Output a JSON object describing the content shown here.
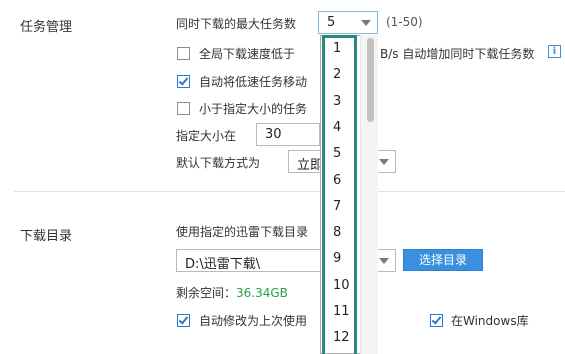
{
  "task_section": {
    "title": "任务管理",
    "max_tasks_label": "同时下载的最大任务数",
    "max_tasks_value": "5",
    "max_tasks_range": "(1-50)",
    "global_speed_label": "全局下载速度低于",
    "global_speed_suffix": "B/s 自动增加同时下载任务数",
    "global_speed_checked": false,
    "auto_move_label": "自动将低速任务移动",
    "auto_move_checked": true,
    "small_task_label": "小于指定大小的任务",
    "small_task_checked": false,
    "size_label": "指定大小在",
    "size_value": "30",
    "default_mode_label": "默认下载方式为",
    "default_mode_value": "立即"
  },
  "dir_section": {
    "title": "下载目录",
    "use_dir_label": "使用指定的迅雷下载目录",
    "dir_value": "D:\\迅雷下载\\",
    "choose_button": "选择目录",
    "free_space_label": "剩余空间：",
    "free_space_value": "36.34GB",
    "auto_modify_label": "自动修改为上次使用",
    "auto_modify_checked": true,
    "windows_lib_label": "在Windows库",
    "windows_lib_checked": true
  },
  "dropdown": {
    "options": [
      "1",
      "2",
      "3",
      "4",
      "5",
      "6",
      "7",
      "8",
      "9",
      "10",
      "11",
      "12"
    ]
  },
  "icons": {
    "info": "info-icon",
    "dropdown_arrow": "chevron-down-icon",
    "check": "check-icon"
  },
  "colors": {
    "accent": "#3a8fe0",
    "highlight_border": "#2a8a7a",
    "free_space": "#27a04a"
  }
}
